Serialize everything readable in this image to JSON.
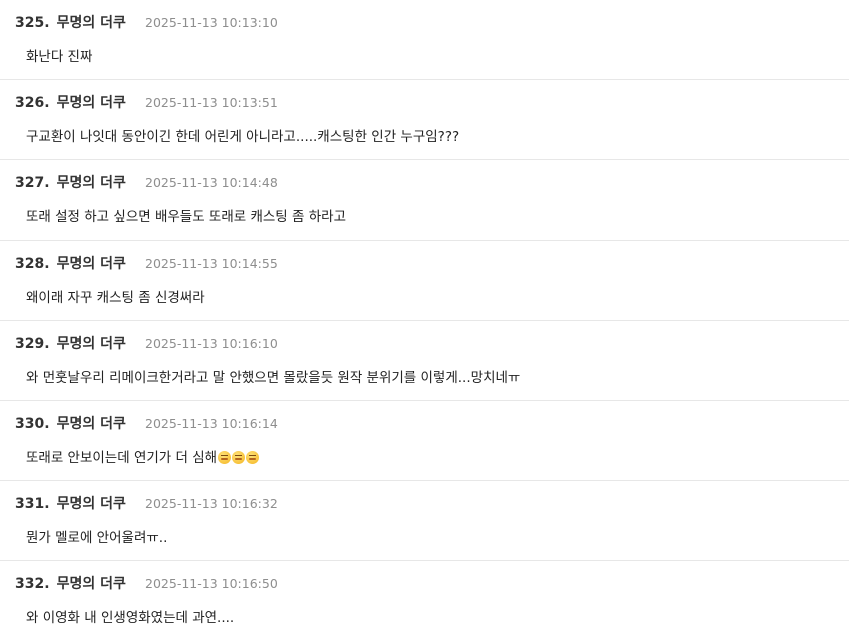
{
  "comments": [
    {
      "number": "325.",
      "author": "무명의 더쿠",
      "timestamp": "2025-11-13 10:13:10",
      "text": "화난다 진짜"
    },
    {
      "number": "326.",
      "author": "무명의 더쿠",
      "timestamp": "2025-11-13 10:13:51",
      "text": "구교환이 나잇대 동안이긴 한데 어린게 아니라고.....캐스팅한 인간 누구임???"
    },
    {
      "number": "327.",
      "author": "무명의 더쿠",
      "timestamp": "2025-11-13 10:14:48",
      "text": "또래 설정 하고 싶으면 배우들도 또래로 캐스팅 좀 하라고"
    },
    {
      "number": "328.",
      "author": "무명의 더쿠",
      "timestamp": "2025-11-13 10:14:55",
      "text": "왜이래 자꾸 캐스팅 좀 신경써라"
    },
    {
      "number": "329.",
      "author": "무명의 더쿠",
      "timestamp": "2025-11-13 10:16:10",
      "text": "와 먼훗날우리 리메이크한거라고 말 안했으면 몰랐을듯 원작 분위기를 이렇게...망치네ㅠ"
    },
    {
      "number": "330.",
      "author": "무명의 더쿠",
      "timestamp": "2025-11-13 10:16:14",
      "text": "또래로 안보이는데 연기가 더 심해",
      "emoji_icons": [
        "weary-face-icon",
        "weary-face-icon",
        "weary-face-icon"
      ]
    },
    {
      "number": "331.",
      "author": "무명의 더쿠",
      "timestamp": "2025-11-13 10:16:32",
      "text": "뭔가 멜로에 안어울려ㅠ.."
    },
    {
      "number": "332.",
      "author": "무명의 더쿠",
      "timestamp": "2025-11-13 10:16:50",
      "text": "와 이영화 내 인생영화였는데 과연...."
    }
  ],
  "colors": {
    "number_author": "#333333",
    "timestamp": "#8e8e8e",
    "body_text": "#222222",
    "divider": "#e7e7e7",
    "background": "#ffffff"
  }
}
